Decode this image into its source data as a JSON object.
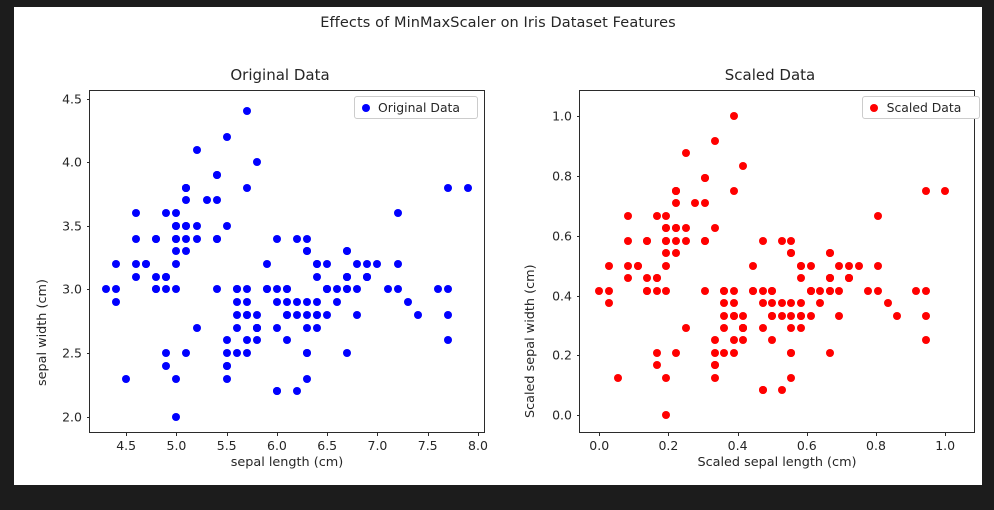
{
  "figure": {
    "suptitle": "Effects of MinMaxScaler on Iris Dataset Features",
    "background": "#ffffff",
    "page_background": "#1c1c1c"
  },
  "chart_data": [
    {
      "type": "scatter",
      "title": "Original Data",
      "xlabel": "sepal length (cm)",
      "ylabel": "sepal width (cm)",
      "xlim": [
        4.14,
        8.06
      ],
      "ylim": [
        1.88,
        4.56
      ],
      "xticks": [
        4.5,
        5.0,
        5.5,
        6.0,
        6.5,
        7.0,
        7.5,
        8.0
      ],
      "xticklabels": [
        "4.5",
        "5.0",
        "5.5",
        "6.0",
        "6.5",
        "7.0",
        "7.5",
        "8.0"
      ],
      "yticks": [
        2.0,
        2.5,
        3.0,
        3.5,
        4.0,
        4.5
      ],
      "yticklabels": [
        "2.0",
        "2.5",
        "3.0",
        "3.5",
        "4.0",
        "4.5"
      ],
      "grid": false,
      "legend": {
        "position": "upper right",
        "entries": [
          {
            "label": "Original Data",
            "color": "#0000ff",
            "marker": "circle"
          }
        ]
      },
      "series": [
        {
          "name": "Original Data",
          "color": "#0000ff",
          "marker": "circle",
          "marker_size": 8,
          "x": [
            5.1,
            4.9,
            4.7,
            4.6,
            5.0,
            5.4,
            4.6,
            5.0,
            4.4,
            4.9,
            5.4,
            4.8,
            4.8,
            4.3,
            5.8,
            5.7,
            5.4,
            5.1,
            5.7,
            5.1,
            5.4,
            5.1,
            4.6,
            5.1,
            4.8,
            5.0,
            5.0,
            5.2,
            5.2,
            4.7,
            4.8,
            5.4,
            5.2,
            5.5,
            4.9,
            5.0,
            5.5,
            4.9,
            4.4,
            5.1,
            5.0,
            4.5,
            4.4,
            5.0,
            5.1,
            4.8,
            5.1,
            4.6,
            5.3,
            5.0,
            7.0,
            6.4,
            6.9,
            5.5,
            6.5,
            5.7,
            6.3,
            4.9,
            6.6,
            5.2,
            5.0,
            5.9,
            6.0,
            6.1,
            5.6,
            6.7,
            5.6,
            5.8,
            6.2,
            5.6,
            5.9,
            6.1,
            6.3,
            6.1,
            6.4,
            6.6,
            6.8,
            6.7,
            6.0,
            5.7,
            5.5,
            5.5,
            5.8,
            6.0,
            5.4,
            6.0,
            6.7,
            6.3,
            5.6,
            5.5,
            5.5,
            6.1,
            5.8,
            5.0,
            5.6,
            5.7,
            5.7,
            6.2,
            5.1,
            5.7,
            6.3,
            5.8,
            7.1,
            6.3,
            6.5,
            7.6,
            4.9,
            7.3,
            6.7,
            7.2,
            6.5,
            6.4,
            6.8,
            5.7,
            5.8,
            6.4,
            6.5,
            7.7,
            7.7,
            6.0,
            6.9,
            5.6,
            7.7,
            6.3,
            6.7,
            7.2,
            6.2,
            6.1,
            6.4,
            7.2,
            7.4,
            7.9,
            6.4,
            6.3,
            6.1,
            7.7,
            6.3,
            6.4,
            6.0,
            6.9,
            6.7,
            6.9,
            5.8,
            6.8,
            6.7,
            6.7,
            6.3,
            6.5,
            6.2,
            5.9
          ],
          "y": [
            3.5,
            3.0,
            3.2,
            3.1,
            3.6,
            3.9,
            3.4,
            3.4,
            2.9,
            3.1,
            3.7,
            3.4,
            3.0,
            3.0,
            4.0,
            4.4,
            3.9,
            3.5,
            3.8,
            3.8,
            3.4,
            3.7,
            3.6,
            3.3,
            3.4,
            3.0,
            3.4,
            3.5,
            3.4,
            3.2,
            3.1,
            3.4,
            4.1,
            4.2,
            3.1,
            3.2,
            3.5,
            3.6,
            3.0,
            3.4,
            3.5,
            2.3,
            3.2,
            3.5,
            3.8,
            3.0,
            3.8,
            3.2,
            3.7,
            3.3,
            3.2,
            3.2,
            3.1,
            2.3,
            2.8,
            2.8,
            3.3,
            2.4,
            2.9,
            2.7,
            2.0,
            3.0,
            2.2,
            2.9,
            2.9,
            3.1,
            3.0,
            2.7,
            2.2,
            2.5,
            3.2,
            2.8,
            2.5,
            2.8,
            2.9,
            3.0,
            2.8,
            3.0,
            2.9,
            2.6,
            2.4,
            2.4,
            2.7,
            2.7,
            3.0,
            3.4,
            3.1,
            2.3,
            3.0,
            2.5,
            2.6,
            3.0,
            2.6,
            2.3,
            2.7,
            3.0,
            2.9,
            2.9,
            2.5,
            2.8,
            3.3,
            2.7,
            3.0,
            2.9,
            3.0,
            3.0,
            2.5,
            2.9,
            2.5,
            3.6,
            3.2,
            2.7,
            3.0,
            2.5,
            2.8,
            3.2,
            3.0,
            3.8,
            2.6,
            2.2,
            3.2,
            2.8,
            2.8,
            2.7,
            3.3,
            3.2,
            2.8,
            3.0,
            2.8,
            3.0,
            2.8,
            3.8,
            2.8,
            2.8,
            2.6,
            3.0,
            3.4,
            3.1,
            3.0,
            3.1,
            3.1,
            3.1,
            2.7,
            3.2,
            3.3,
            3.0,
            2.5,
            3.0,
            3.4,
            3.0
          ]
        }
      ]
    },
    {
      "type": "scatter",
      "title": "Scaled Data",
      "xlabel": "Scaled sepal length (cm)",
      "ylabel": "Scaled sepal width (cm)",
      "xlim": [
        -0.0556,
        1.0833
      ],
      "ylim": [
        -0.0556,
        1.0833
      ],
      "xticks": [
        0.0,
        0.2,
        0.4,
        0.6,
        0.8,
        1.0
      ],
      "xticklabels": [
        "0.0",
        "0.2",
        "0.4",
        "0.6",
        "0.8",
        "1.0"
      ],
      "yticks": [
        0.0,
        0.2,
        0.4,
        0.6,
        0.8,
        1.0
      ],
      "yticklabels": [
        "0.0",
        "0.2",
        "0.4",
        "0.6",
        "0.8",
        "1.0"
      ],
      "grid": false,
      "legend": {
        "position": "upper right",
        "entries": [
          {
            "label": "Scaled Data",
            "color": "#ff0000",
            "marker": "circle"
          }
        ]
      },
      "transform": {
        "method": "MinMaxScaler",
        "x_min": 4.3,
        "x_max": 7.9,
        "y_min": 2.0,
        "y_max": 4.4
      },
      "series": [
        {
          "name": "Scaled Data",
          "color": "#ff0000",
          "marker": "circle",
          "marker_size": 8,
          "x": [
            0.2222,
            0.1667,
            0.1111,
            0.0833,
            0.1944,
            0.3056,
            0.0833,
            0.1944,
            0.0278,
            0.1667,
            0.3056,
            0.1389,
            0.1389,
            0.0,
            0.4167,
            0.3889,
            0.3056,
            0.2222,
            0.3889,
            0.2222,
            0.3056,
            0.2222,
            0.0833,
            0.2222,
            0.1389,
            0.1944,
            0.1944,
            0.25,
            0.25,
            0.1111,
            0.1389,
            0.3056,
            0.25,
            0.3333,
            0.1667,
            0.1944,
            0.3333,
            0.1667,
            0.0278,
            0.2222,
            0.1944,
            0.0556,
            0.0278,
            0.1944,
            0.2222,
            0.1389,
            0.2222,
            0.0833,
            0.2778,
            0.1944,
            0.75,
            0.5833,
            0.7222,
            0.3333,
            0.6111,
            0.3889,
            0.5556,
            0.1667,
            0.6389,
            0.25,
            0.1944,
            0.4444,
            0.4722,
            0.5,
            0.3611,
            0.6667,
            0.3611,
            0.4167,
            0.5278,
            0.3611,
            0.4444,
            0.5,
            0.5556,
            0.5,
            0.5833,
            0.6389,
            0.6944,
            0.6667,
            0.4722,
            0.3889,
            0.3333,
            0.3333,
            0.4167,
            0.4722,
            0.3056,
            0.4722,
            0.6667,
            0.5556,
            0.3611,
            0.3333,
            0.3333,
            0.5,
            0.4167,
            0.1944,
            0.3611,
            0.3889,
            0.3889,
            0.5278,
            0.2222,
            0.3889,
            0.5556,
            0.4167,
            0.7778,
            0.5556,
            0.6111,
            0.9167,
            0.1667,
            0.8333,
            0.6667,
            0.8056,
            0.6111,
            0.5833,
            0.6944,
            0.3889,
            0.4167,
            0.5833,
            0.6111,
            0.9444,
            0.9444,
            0.4722,
            0.7222,
            0.3611,
            0.9444,
            0.5556,
            0.6667,
            0.8056,
            0.5278,
            0.5,
            0.5833,
            0.8056,
            0.8611,
            1.0,
            0.5833,
            0.5556,
            0.5,
            0.9444,
            0.5556,
            0.5833,
            0.4722,
            0.7222,
            0.6667,
            0.7222,
            0.4167,
            0.6944,
            0.6667,
            0.6667,
            0.5556,
            0.6111,
            0.5278,
            0.4444
          ],
          "y": [
            0.625,
            0.4167,
            0.5,
            0.4583,
            0.6667,
            0.7917,
            0.5833,
            0.5833,
            0.375,
            0.4583,
            0.7083,
            0.5833,
            0.4167,
            0.4167,
            0.8333,
            1.0,
            0.7917,
            0.625,
            0.75,
            0.75,
            0.5833,
            0.7083,
            0.6667,
            0.5417,
            0.5833,
            0.4167,
            0.5833,
            0.625,
            0.5833,
            0.5,
            0.4583,
            0.5833,
            0.875,
            0.9167,
            0.4583,
            0.5,
            0.625,
            0.6667,
            0.4167,
            0.5833,
            0.625,
            0.125,
            0.5,
            0.625,
            0.75,
            0.4167,
            0.75,
            0.5,
            0.7083,
            0.5417,
            0.5,
            0.5,
            0.4583,
            0.125,
            0.3333,
            0.3333,
            0.5417,
            0.1667,
            0.375,
            0.2917,
            0.0,
            0.4167,
            0.0833,
            0.375,
            0.375,
            0.4583,
            0.4167,
            0.2917,
            0.0833,
            0.2083,
            0.5,
            0.3333,
            0.2083,
            0.3333,
            0.375,
            0.4167,
            0.3333,
            0.4167,
            0.375,
            0.25,
            0.1667,
            0.1667,
            0.2917,
            0.2917,
            0.4167,
            0.5833,
            0.4583,
            0.125,
            0.4167,
            0.2083,
            0.25,
            0.4167,
            0.25,
            0.125,
            0.2917,
            0.4167,
            0.375,
            0.375,
            0.2083,
            0.3333,
            0.5417,
            0.2917,
            0.4167,
            0.375,
            0.4167,
            0.4167,
            0.2083,
            0.375,
            0.2083,
            0.6667,
            0.5,
            0.2917,
            0.4167,
            0.2083,
            0.3333,
            0.5,
            0.4167,
            0.75,
            0.25,
            0.0833,
            0.5,
            0.3333,
            0.3333,
            0.2917,
            0.5417,
            0.5,
            0.3333,
            0.4167,
            0.3333,
            0.4167,
            0.3333,
            0.75,
            0.3333,
            0.3333,
            0.25,
            0.4167,
            0.5833,
            0.4583,
            0.4167,
            0.4583,
            0.4583,
            0.4583,
            0.2917,
            0.5,
            0.5417,
            0.4167,
            0.2083,
            0.4167,
            0.5833,
            0.4167
          ]
        }
      ]
    }
  ]
}
